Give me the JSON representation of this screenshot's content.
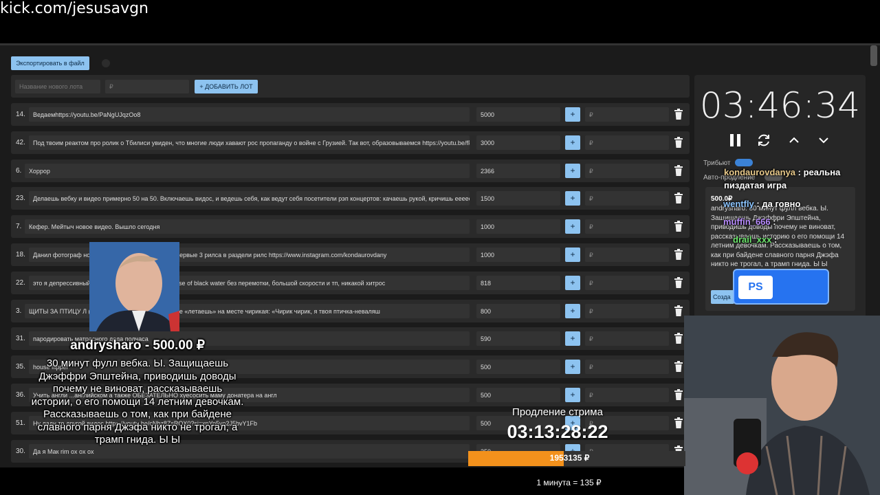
{
  "url_overlay": "kick.com/jesusavgn",
  "toolbar": {
    "export_label": "Экспортировать в файл"
  },
  "add_lot": {
    "name_placeholder": "Название нового лота",
    "amount_placeholder": "₽",
    "button_label": "+ ДОБАВИТЬ ЛОТ"
  },
  "lots": [
    {
      "num": "14.",
      "text": "Ведаемhttps://youtu.be/PaNgUJqzOo8",
      "amount": "5000"
    },
    {
      "num": "42.",
      "text": "Под твоим реактом про ролик о Тбилиси увиден, что многие люди хавают рос пропаганду о войне с Грузией. Так вот, образовываемся https://youtu.be/fFV",
      "amount": "3000"
    },
    {
      "num": "6.",
      "text": "Хоррор",
      "amount": "2366"
    },
    {
      "num": "23.",
      "text": "Делаешь вебку и видео примерно 50 на 50. Включаешь видос, и ведешь себя, как ведут себя посетители рэп концертов: качаешь рукой, кричишь еееее, и",
      "amount": "1500"
    },
    {
      "num": "7.",
      "text": "Кефер. Мейтыч новое видео. Вышло сегодня",
      "amount": "1000"
    },
    {
      "num": "18.",
      "text": "Данил фотограф но                                   мой инстаграмм, и посмотри первые 3 рилса в раздели рилс https://www.instagram.com/kondaurovdany",
      "amount": "1000"
    },
    {
      "num": "22.",
      "text": "это я депрессивный                                  листа по прохождерию the curse of black water без перемотки, большой скорости и тп, никакой хитрос",
      "amount": "818"
    },
    {
      "num": "3.",
      "text": "ЩИТЫ ЗА ПТИЦУ Л                                 (ладошки крылышки)и час после «летаешь» на месте чирикая: «Чирик чирик, я твоя птичка-неваляш",
      "amount": "800"
    },
    {
      "num": "31.",
      "text": "пародировать матрасного деда полчаса",
      "amount": "590"
    },
    {
      "num": "35.",
      "text": "house flipper",
      "amount": "500"
    },
    {
      "num": "36.",
      "text": "Учить англи                            ...английском а также ОБЕЗАТЕЛЬНО хуесосить маму донатера на англ",
      "amount": "500"
    },
    {
      "num": "51.",
      "text": "Ну ладн                                       то другой видос https://youtu.be/cNbz8ZsROX0?si=xnYp5yo2J5bvY1Fb",
      "amount": "500"
    },
    {
      "num": "30.",
      "text": "Да я Мак                                       rim ox ox ox",
      "amount": "350"
    }
  ],
  "lot_currency": "₽",
  "timer": {
    "value": "03:46:34",
    "tribute_label": "Трибьют",
    "autoextend_label": "Авто-продление"
  },
  "lot_card": {
    "amount": "500.0₽",
    "text": "andrysharo: 30 минут фулл вебка. Ы. Защищаешь Джэффри Эпштейна, приводишь доводы почему не виноват, рассказываешь историю о его помощи 14 летним девочкам. Рассказываешь о том, как при байдене славного парня Джэфа никто не трогал, а трамп гнида. Ы Ы",
    "button": "Созда"
  },
  "chat": [
    {
      "user": "kondaurovdanya",
      "msg": " : реальна пиздатая игра"
    },
    {
      "user": "wentfly",
      "msg": " : да говно"
    },
    {
      "user": "muffin_666",
      "msg": " :"
    },
    {
      "user": "drail_xxx",
      "msg": " :"
    }
  ],
  "ps_badge": "PS",
  "donation": {
    "name": "andrysharo - 500.00 ₽",
    "text": "30 минут фулл вебка. Ы. Защищаешь Джэффри Эпштейна, приводишь доводы почему не виноват, рассказываешь истории, о его помощи 14 летним девочкам. Рассказываешь о том, как при байдене славного парня Джэфа никто не трогал, а трамп гнида. Ы Ы"
  },
  "extension": {
    "label": "Продление стрима",
    "time": "03:13:28:22",
    "progress_value": "1953135 ₽",
    "progress_fraction": 0.44,
    "rate": "1 минута = 135 ₽"
  },
  "colors": {
    "accent": "#8dc3f0",
    "progress": "#f3911c",
    "ps": "#2673f0"
  }
}
